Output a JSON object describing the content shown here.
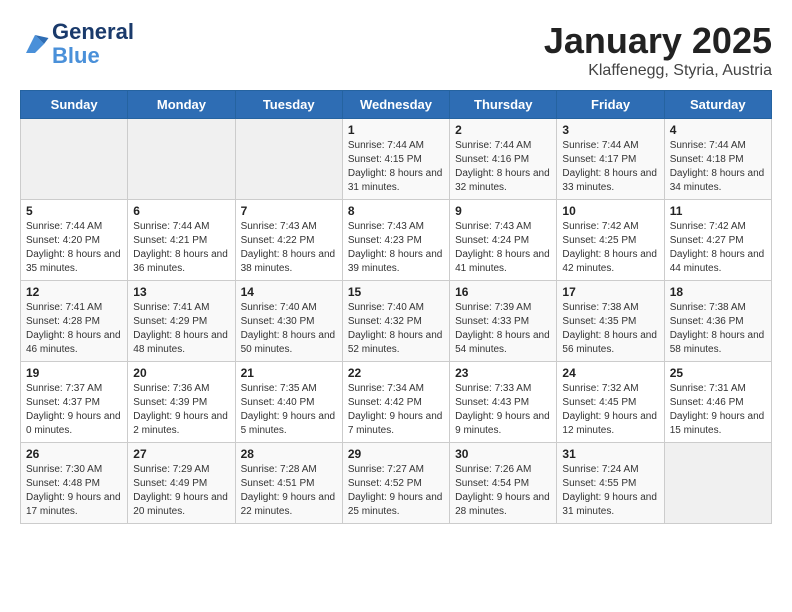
{
  "header": {
    "logo_line1": "General",
    "logo_line2": "Blue",
    "title": "January 2025",
    "subtitle": "Klaffenegg, Styria, Austria"
  },
  "weekdays": [
    "Sunday",
    "Monday",
    "Tuesday",
    "Wednesday",
    "Thursday",
    "Friday",
    "Saturday"
  ],
  "weeks": [
    [
      {
        "day": "",
        "info": ""
      },
      {
        "day": "",
        "info": ""
      },
      {
        "day": "",
        "info": ""
      },
      {
        "day": "1",
        "info": "Sunrise: 7:44 AM\nSunset: 4:15 PM\nDaylight: 8 hours and 31 minutes."
      },
      {
        "day": "2",
        "info": "Sunrise: 7:44 AM\nSunset: 4:16 PM\nDaylight: 8 hours and 32 minutes."
      },
      {
        "day": "3",
        "info": "Sunrise: 7:44 AM\nSunset: 4:17 PM\nDaylight: 8 hours and 33 minutes."
      },
      {
        "day": "4",
        "info": "Sunrise: 7:44 AM\nSunset: 4:18 PM\nDaylight: 8 hours and 34 minutes."
      }
    ],
    [
      {
        "day": "5",
        "info": "Sunrise: 7:44 AM\nSunset: 4:20 PM\nDaylight: 8 hours and 35 minutes."
      },
      {
        "day": "6",
        "info": "Sunrise: 7:44 AM\nSunset: 4:21 PM\nDaylight: 8 hours and 36 minutes."
      },
      {
        "day": "7",
        "info": "Sunrise: 7:43 AM\nSunset: 4:22 PM\nDaylight: 8 hours and 38 minutes."
      },
      {
        "day": "8",
        "info": "Sunrise: 7:43 AM\nSunset: 4:23 PM\nDaylight: 8 hours and 39 minutes."
      },
      {
        "day": "9",
        "info": "Sunrise: 7:43 AM\nSunset: 4:24 PM\nDaylight: 8 hours and 41 minutes."
      },
      {
        "day": "10",
        "info": "Sunrise: 7:42 AM\nSunset: 4:25 PM\nDaylight: 8 hours and 42 minutes."
      },
      {
        "day": "11",
        "info": "Sunrise: 7:42 AM\nSunset: 4:27 PM\nDaylight: 8 hours and 44 minutes."
      }
    ],
    [
      {
        "day": "12",
        "info": "Sunrise: 7:41 AM\nSunset: 4:28 PM\nDaylight: 8 hours and 46 minutes."
      },
      {
        "day": "13",
        "info": "Sunrise: 7:41 AM\nSunset: 4:29 PM\nDaylight: 8 hours and 48 minutes."
      },
      {
        "day": "14",
        "info": "Sunrise: 7:40 AM\nSunset: 4:30 PM\nDaylight: 8 hours and 50 minutes."
      },
      {
        "day": "15",
        "info": "Sunrise: 7:40 AM\nSunset: 4:32 PM\nDaylight: 8 hours and 52 minutes."
      },
      {
        "day": "16",
        "info": "Sunrise: 7:39 AM\nSunset: 4:33 PM\nDaylight: 8 hours and 54 minutes."
      },
      {
        "day": "17",
        "info": "Sunrise: 7:38 AM\nSunset: 4:35 PM\nDaylight: 8 hours and 56 minutes."
      },
      {
        "day": "18",
        "info": "Sunrise: 7:38 AM\nSunset: 4:36 PM\nDaylight: 8 hours and 58 minutes."
      }
    ],
    [
      {
        "day": "19",
        "info": "Sunrise: 7:37 AM\nSunset: 4:37 PM\nDaylight: 9 hours and 0 minutes."
      },
      {
        "day": "20",
        "info": "Sunrise: 7:36 AM\nSunset: 4:39 PM\nDaylight: 9 hours and 2 minutes."
      },
      {
        "day": "21",
        "info": "Sunrise: 7:35 AM\nSunset: 4:40 PM\nDaylight: 9 hours and 5 minutes."
      },
      {
        "day": "22",
        "info": "Sunrise: 7:34 AM\nSunset: 4:42 PM\nDaylight: 9 hours and 7 minutes."
      },
      {
        "day": "23",
        "info": "Sunrise: 7:33 AM\nSunset: 4:43 PM\nDaylight: 9 hours and 9 minutes."
      },
      {
        "day": "24",
        "info": "Sunrise: 7:32 AM\nSunset: 4:45 PM\nDaylight: 9 hours and 12 minutes."
      },
      {
        "day": "25",
        "info": "Sunrise: 7:31 AM\nSunset: 4:46 PM\nDaylight: 9 hours and 15 minutes."
      }
    ],
    [
      {
        "day": "26",
        "info": "Sunrise: 7:30 AM\nSunset: 4:48 PM\nDaylight: 9 hours and 17 minutes."
      },
      {
        "day": "27",
        "info": "Sunrise: 7:29 AM\nSunset: 4:49 PM\nDaylight: 9 hours and 20 minutes."
      },
      {
        "day": "28",
        "info": "Sunrise: 7:28 AM\nSunset: 4:51 PM\nDaylight: 9 hours and 22 minutes."
      },
      {
        "day": "29",
        "info": "Sunrise: 7:27 AM\nSunset: 4:52 PM\nDaylight: 9 hours and 25 minutes."
      },
      {
        "day": "30",
        "info": "Sunrise: 7:26 AM\nSunset: 4:54 PM\nDaylight: 9 hours and 28 minutes."
      },
      {
        "day": "31",
        "info": "Sunrise: 7:24 AM\nSunset: 4:55 PM\nDaylight: 9 hours and 31 minutes."
      },
      {
        "day": "",
        "info": ""
      }
    ]
  ]
}
